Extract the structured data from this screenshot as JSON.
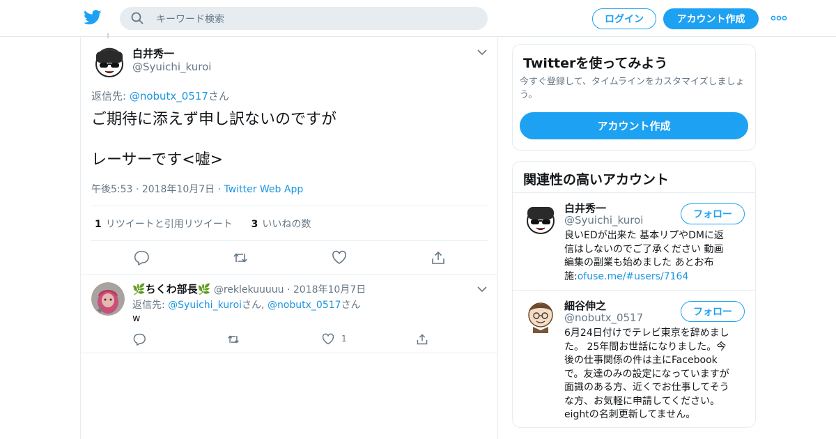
{
  "header": {
    "search_placeholder": "キーワード検索",
    "login_label": "ログイン",
    "signup_label": "アカウント作成"
  },
  "tweet": {
    "author_name": "白井秀一",
    "author_handle": "@Syuichi_kuroi",
    "reply_prefix": "返信先: ",
    "reply_to": "@nobutx_0517",
    "reply_suffix": "さん",
    "text_line1": "ご期待に添えず申し訳ないのですが",
    "text_line2": "",
    "text_line3": "レーサーです<嘘>",
    "time": "午後5:53",
    "date": "2018年10月7日",
    "source": "Twitter Web App",
    "retweet_count": "1",
    "retweet_label": "リツイートと引用リツイート",
    "like_count": "3",
    "like_label": "いいねの数"
  },
  "reply": {
    "author_name": "🌿ちくわ部長🌿",
    "author_handle": "@reklekuuuuu",
    "date": "2018年10月7日",
    "reply_prefix": "返信先: ",
    "reply_to_1": "@Syuichi_kuroi",
    "reply_mid": "さん, ",
    "reply_to_2": "@nobutx_0517",
    "reply_suffix": "さん",
    "text": "w",
    "like_count": "1"
  },
  "signup_card": {
    "title": "Twitterを使ってみよう",
    "desc_line1": "今すぐ登録して、タイムラインをカスタマイズしましょ",
    "desc_line2": "う。",
    "button": "アカウント作成"
  },
  "related_card": {
    "title": "関連性の高いアカウント",
    "follow_label": "フォロー",
    "accounts": [
      {
        "name": "白井秀一",
        "handle": "@Syuichi_kuroi",
        "bio_lines": [
          "良いEDが出来た 基本リプやDMに返",
          "信はしないのでご了承ください 動画",
          "編集の副業も始めました あとお布",
          "施:"
        ],
        "bio_link": "ofuse.me/#users/7164"
      },
      {
        "name": "細谷伸之",
        "handle": "@nobutx_0517",
        "bio_lines": [
          "6月24日付けでテレビ東京を辞めまし",
          "た。 25年間お世話になりました。今",
          "後の仕事関係の件は主にFacebook",
          "で。友達のみの設定になっていますが",
          "面識のある方、近くでお仕事してそう",
          "な方、お気軽に申請してください。",
          "eightの名刺更新してません。"
        ]
      }
    ]
  },
  "colors": {
    "accent": "#1da1f2",
    "link": "#1b95e0",
    "muted": "#657786",
    "text": "#14171a",
    "border": "#e6ecf0",
    "search_bg": "#e6ecf0"
  },
  "icons": [
    "twitter-bird-icon",
    "search-icon",
    "more-dots-icon",
    "chevron-down-icon",
    "reply-icon",
    "retweet-icon",
    "like-icon",
    "share-icon"
  ]
}
